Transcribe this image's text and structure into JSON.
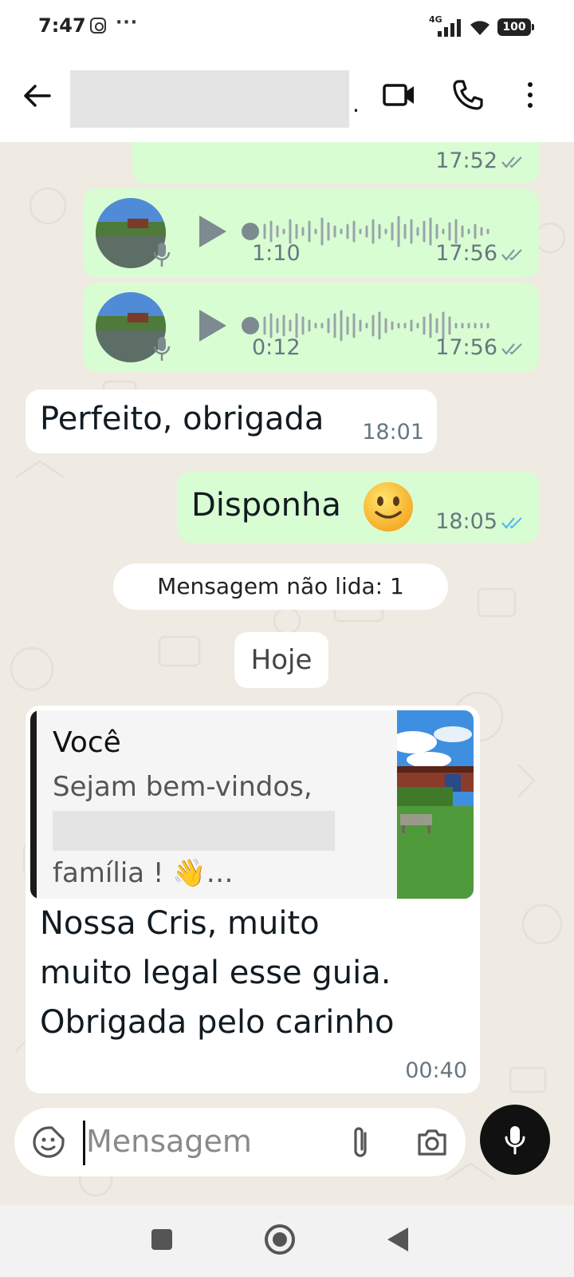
{
  "status_bar": {
    "time": "7:47",
    "more": "···",
    "network": "4G",
    "battery": "100"
  },
  "header": {
    "contact_suffix": "."
  },
  "messages": {
    "top_partial": {
      "time": "17:52"
    },
    "voice1": {
      "duration": "1:10",
      "time": "17:56"
    },
    "voice2": {
      "duration": "0:12",
      "time": "17:56"
    },
    "incoming1": {
      "text": "Perfeito, obrigada",
      "time": "18:01"
    },
    "outgoing1": {
      "text": "Disponha",
      "time": "18:05"
    },
    "unread_banner": "Mensagem não lida: 1",
    "date_divider": "Hoje",
    "reply": {
      "quote_author": "Você",
      "quote_line1": "Sejam bem-vindos,",
      "quote_line3": "família ! 👋…",
      "lines": [
        "Nossa Cris, muito",
        "muito legal esse guia.",
        "Obrigada pelo carinho"
      ],
      "time": "00:40"
    }
  },
  "input": {
    "placeholder": "Mensagem"
  },
  "colors": {
    "outgoing_bubble": "#d9fdd3",
    "incoming_bubble": "#ffffff",
    "chat_background": "#efeae2",
    "read_ticks": "#53bdeb",
    "mic_button": "#111111"
  }
}
